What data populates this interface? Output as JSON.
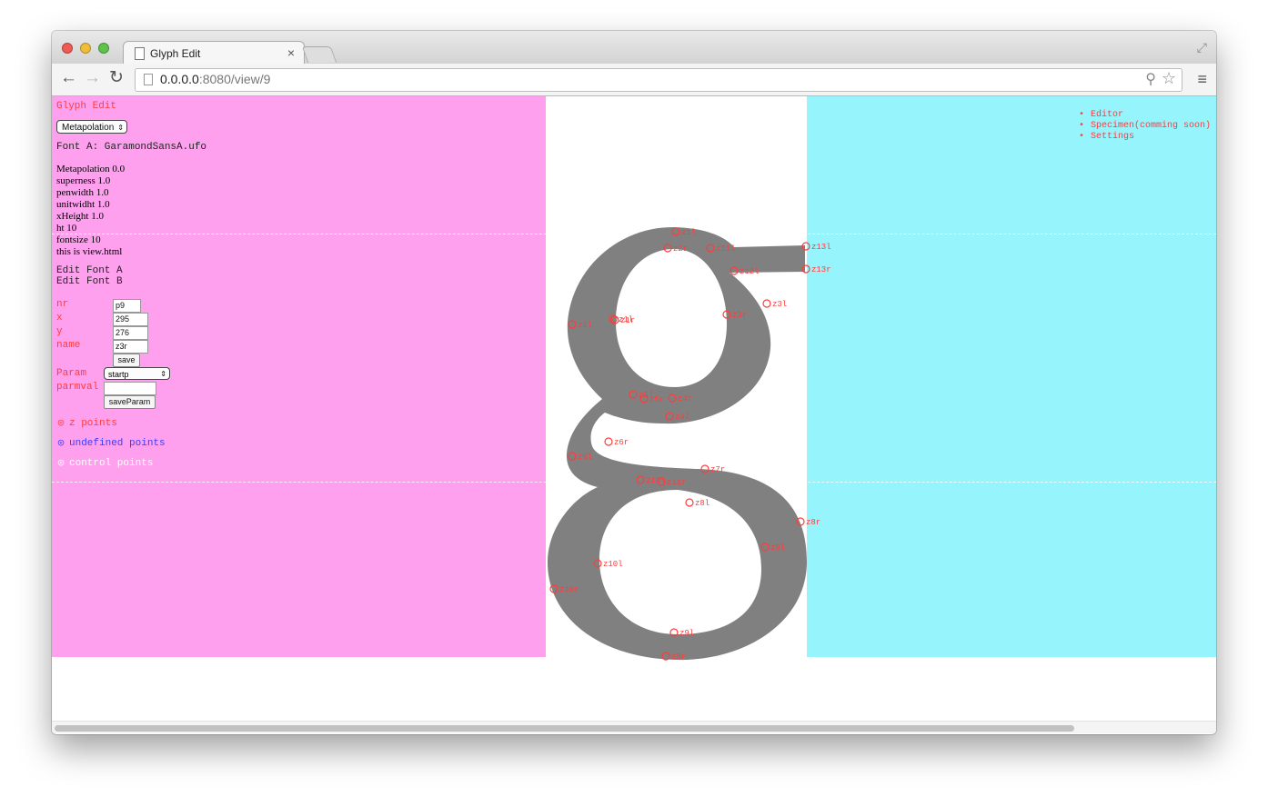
{
  "browser": {
    "tab_title": "Glyph Edit",
    "tab_close": "×",
    "url_host": "0.0.0.0",
    "url_rest": ":8080/view/9",
    "back_glyph": "←",
    "forward_glyph": "→",
    "reload_glyph": "↻",
    "zoom_glyph": "⚲",
    "star_glyph": "☆",
    "menu_glyph": "≡",
    "fullscreen_glyph": "⤢"
  },
  "app": {
    "title": "Glyph Edit",
    "mode_select": "Metapolation",
    "font_a": "Font A: GaramondSansA.ufo",
    "stats": [
      "Metapolation 0.0",
      "superness 1.0",
      "penwidth 1.0",
      "unitwidht 1.0",
      "xHeight 1.0",
      "ht 10",
      "fontsize 10",
      "this is view.html"
    ],
    "edit_font_a": "Edit Font A",
    "edit_font_b": "Edit Font B"
  },
  "point_form": {
    "nr_label": "nr",
    "nr_value": "p9",
    "x_label": "x",
    "x_value": "295",
    "y_label": "y",
    "y_value": "276",
    "name_label": "name",
    "name_value": "z3r",
    "save_label": "save",
    "param_label": "Param",
    "param_select": "startp",
    "parmval_label": "parmval",
    "parmval_value": "",
    "save_param_label": "saveParam"
  },
  "legend": [
    {
      "label": "z points",
      "color": "#ff3c3c"
    },
    {
      "label": "undefined points",
      "color": "#3b3bff"
    },
    {
      "label": "control points",
      "color": "#ffffff"
    }
  ],
  "nav": [
    {
      "label": "Editor"
    },
    {
      "label": "Specimen(comming soon)"
    },
    {
      "label": "Settings"
    }
  ],
  "glyph": {
    "character": "g",
    "fill_color": "#808080",
    "point_color": "#ff3c3c",
    "point_labels": [
      "z1l",
      "z2l",
      "z2r",
      "z11l",
      "z13l",
      "z13r",
      "z12l",
      "z3l",
      "z3r",
      "z1r",
      "z5l",
      "z5r",
      "z4l",
      "z4r",
      "z6r",
      "z6l",
      "z7r",
      "z10l",
      "z11r",
      "z8l",
      "z8r",
      "z9l",
      "z10l",
      "z10r",
      "z9l",
      "z9r"
    ]
  },
  "colors": {
    "left_panel": "#ffa0ef",
    "right_panel": "#96f4fc",
    "red_text": "#ff3c3c"
  }
}
